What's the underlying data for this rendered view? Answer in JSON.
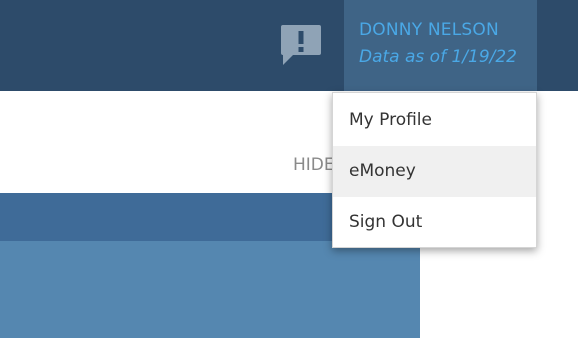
{
  "header": {
    "feedback_icon": "feedback-exclamation-icon",
    "user": {
      "name": "DONNY NELSON",
      "data_as_of": "Data as of 1/19/22"
    }
  },
  "content": {
    "hide_label": "HIDE"
  },
  "user_menu": {
    "items": [
      {
        "label": "My Profile"
      },
      {
        "label": "eMoney"
      },
      {
        "label": "Sign Out"
      }
    ],
    "highlighted": "eMoney"
  },
  "colors": {
    "header_bg": "#2d4b6a",
    "user_box_bg": "#3f6486",
    "accent_text": "#4aa8e6",
    "panel_dark": "#3f6b98",
    "panel_light": "#5587b0"
  }
}
